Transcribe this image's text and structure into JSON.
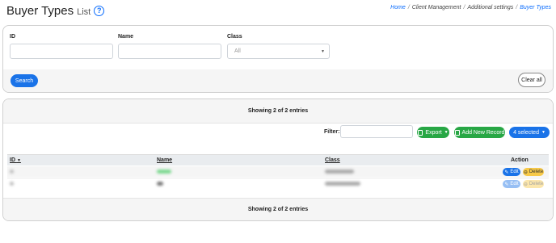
{
  "header": {
    "title": "Buyer Types",
    "subtitle": "List",
    "help_icon": "question-circle-icon"
  },
  "breadcrumb": [
    {
      "label": "Home",
      "link": true
    },
    {
      "label": "Client Management",
      "link": false
    },
    {
      "label": "Additional settings",
      "link": false
    },
    {
      "label": "Buyer Types",
      "link": true
    }
  ],
  "filters": {
    "id_label": "ID",
    "name_label": "Name",
    "class_label": "Class",
    "class_value": "All",
    "search_label": "Search",
    "clear_label": "Clear all"
  },
  "list": {
    "showing_top": "Showing 2 of 2 entries",
    "showing_bottom": "Showing 2 of 2 entries",
    "filter_label": "Filter:",
    "export_label": "Export",
    "add_label": "Add New Record",
    "selected_label": "4 selected",
    "columns": {
      "id": "ID",
      "name": "Name",
      "class": "Class",
      "action": "Action"
    },
    "row_actions": {
      "edit": "Edit",
      "delete": "Delete"
    }
  },
  "colors": {
    "primary": "#1a73e8",
    "success": "#28a745",
    "warning": "#f7c948"
  }
}
